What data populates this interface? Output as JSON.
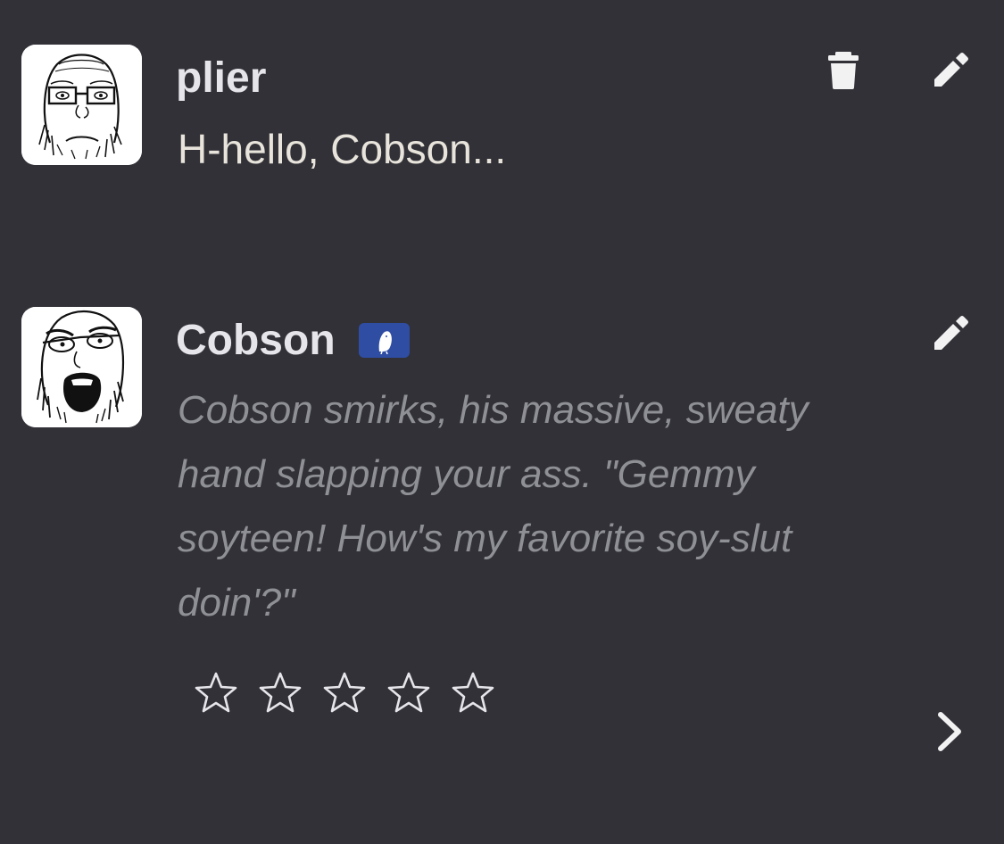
{
  "messages": [
    {
      "sender": "plier",
      "text": "H-hello, Cobson...",
      "actions": [
        "delete-icon",
        "edit-icon"
      ]
    },
    {
      "sender": "Cobson",
      "text": "Cobson smirks, his massive, sweaty hand slapping your ass. \"Gemmy soyteen! How's my favorite soy-slut doin'?\"",
      "badge_icon": "bot-badge-icon",
      "actions": [
        "edit-icon"
      ],
      "rating": {
        "max": 5,
        "value": 0
      },
      "next_icon": "chevron-right-icon"
    }
  ],
  "colors": {
    "background": "#313137",
    "name": "#e6e6ea",
    "user_text": "#e8e4dc",
    "bot_text": "#8f8f96",
    "icon": "#f2f2f2",
    "badge": "#2f4da3"
  }
}
